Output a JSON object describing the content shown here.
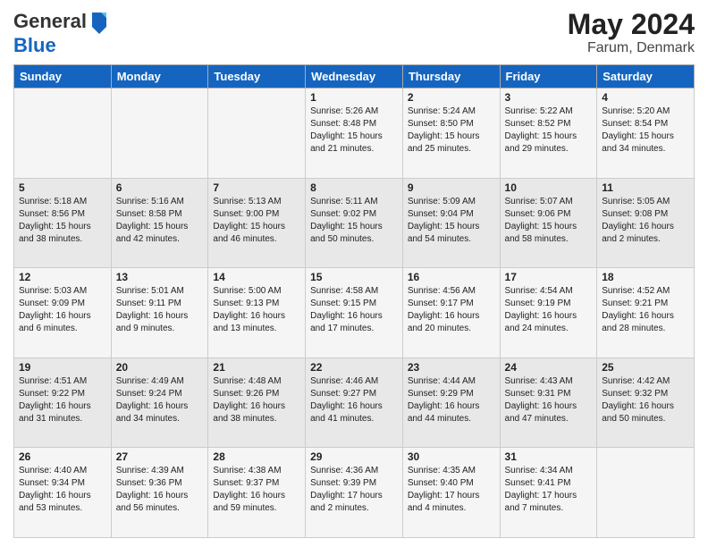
{
  "header": {
    "logo_general": "General",
    "logo_blue": "Blue",
    "title_month": "May 2024",
    "title_location": "Farum, Denmark"
  },
  "days_of_week": [
    "Sunday",
    "Monday",
    "Tuesday",
    "Wednesday",
    "Thursday",
    "Friday",
    "Saturday"
  ],
  "weeks": [
    [
      {
        "day": "",
        "info": ""
      },
      {
        "day": "",
        "info": ""
      },
      {
        "day": "",
        "info": ""
      },
      {
        "day": "1",
        "info": "Sunrise: 5:26 AM\nSunset: 8:48 PM\nDaylight: 15 hours\nand 21 minutes."
      },
      {
        "day": "2",
        "info": "Sunrise: 5:24 AM\nSunset: 8:50 PM\nDaylight: 15 hours\nand 25 minutes."
      },
      {
        "day": "3",
        "info": "Sunrise: 5:22 AM\nSunset: 8:52 PM\nDaylight: 15 hours\nand 29 minutes."
      },
      {
        "day": "4",
        "info": "Sunrise: 5:20 AM\nSunset: 8:54 PM\nDaylight: 15 hours\nand 34 minutes."
      }
    ],
    [
      {
        "day": "5",
        "info": "Sunrise: 5:18 AM\nSunset: 8:56 PM\nDaylight: 15 hours\nand 38 minutes."
      },
      {
        "day": "6",
        "info": "Sunrise: 5:16 AM\nSunset: 8:58 PM\nDaylight: 15 hours\nand 42 minutes."
      },
      {
        "day": "7",
        "info": "Sunrise: 5:13 AM\nSunset: 9:00 PM\nDaylight: 15 hours\nand 46 minutes."
      },
      {
        "day": "8",
        "info": "Sunrise: 5:11 AM\nSunset: 9:02 PM\nDaylight: 15 hours\nand 50 minutes."
      },
      {
        "day": "9",
        "info": "Sunrise: 5:09 AM\nSunset: 9:04 PM\nDaylight: 15 hours\nand 54 minutes."
      },
      {
        "day": "10",
        "info": "Sunrise: 5:07 AM\nSunset: 9:06 PM\nDaylight: 15 hours\nand 58 minutes."
      },
      {
        "day": "11",
        "info": "Sunrise: 5:05 AM\nSunset: 9:08 PM\nDaylight: 16 hours\nand 2 minutes."
      }
    ],
    [
      {
        "day": "12",
        "info": "Sunrise: 5:03 AM\nSunset: 9:09 PM\nDaylight: 16 hours\nand 6 minutes."
      },
      {
        "day": "13",
        "info": "Sunrise: 5:01 AM\nSunset: 9:11 PM\nDaylight: 16 hours\nand 9 minutes."
      },
      {
        "day": "14",
        "info": "Sunrise: 5:00 AM\nSunset: 9:13 PM\nDaylight: 16 hours\nand 13 minutes."
      },
      {
        "day": "15",
        "info": "Sunrise: 4:58 AM\nSunset: 9:15 PM\nDaylight: 16 hours\nand 17 minutes."
      },
      {
        "day": "16",
        "info": "Sunrise: 4:56 AM\nSunset: 9:17 PM\nDaylight: 16 hours\nand 20 minutes."
      },
      {
        "day": "17",
        "info": "Sunrise: 4:54 AM\nSunset: 9:19 PM\nDaylight: 16 hours\nand 24 minutes."
      },
      {
        "day": "18",
        "info": "Sunrise: 4:52 AM\nSunset: 9:21 PM\nDaylight: 16 hours\nand 28 minutes."
      }
    ],
    [
      {
        "day": "19",
        "info": "Sunrise: 4:51 AM\nSunset: 9:22 PM\nDaylight: 16 hours\nand 31 minutes."
      },
      {
        "day": "20",
        "info": "Sunrise: 4:49 AM\nSunset: 9:24 PM\nDaylight: 16 hours\nand 34 minutes."
      },
      {
        "day": "21",
        "info": "Sunrise: 4:48 AM\nSunset: 9:26 PM\nDaylight: 16 hours\nand 38 minutes."
      },
      {
        "day": "22",
        "info": "Sunrise: 4:46 AM\nSunset: 9:27 PM\nDaylight: 16 hours\nand 41 minutes."
      },
      {
        "day": "23",
        "info": "Sunrise: 4:44 AM\nSunset: 9:29 PM\nDaylight: 16 hours\nand 44 minutes."
      },
      {
        "day": "24",
        "info": "Sunrise: 4:43 AM\nSunset: 9:31 PM\nDaylight: 16 hours\nand 47 minutes."
      },
      {
        "day": "25",
        "info": "Sunrise: 4:42 AM\nSunset: 9:32 PM\nDaylight: 16 hours\nand 50 minutes."
      }
    ],
    [
      {
        "day": "26",
        "info": "Sunrise: 4:40 AM\nSunset: 9:34 PM\nDaylight: 16 hours\nand 53 minutes."
      },
      {
        "day": "27",
        "info": "Sunrise: 4:39 AM\nSunset: 9:36 PM\nDaylight: 16 hours\nand 56 minutes."
      },
      {
        "day": "28",
        "info": "Sunrise: 4:38 AM\nSunset: 9:37 PM\nDaylight: 16 hours\nand 59 minutes."
      },
      {
        "day": "29",
        "info": "Sunrise: 4:36 AM\nSunset: 9:39 PM\nDaylight: 17 hours\nand 2 minutes."
      },
      {
        "day": "30",
        "info": "Sunrise: 4:35 AM\nSunset: 9:40 PM\nDaylight: 17 hours\nand 4 minutes."
      },
      {
        "day": "31",
        "info": "Sunrise: 4:34 AM\nSunset: 9:41 PM\nDaylight: 17 hours\nand 7 minutes."
      },
      {
        "day": "",
        "info": ""
      }
    ]
  ]
}
